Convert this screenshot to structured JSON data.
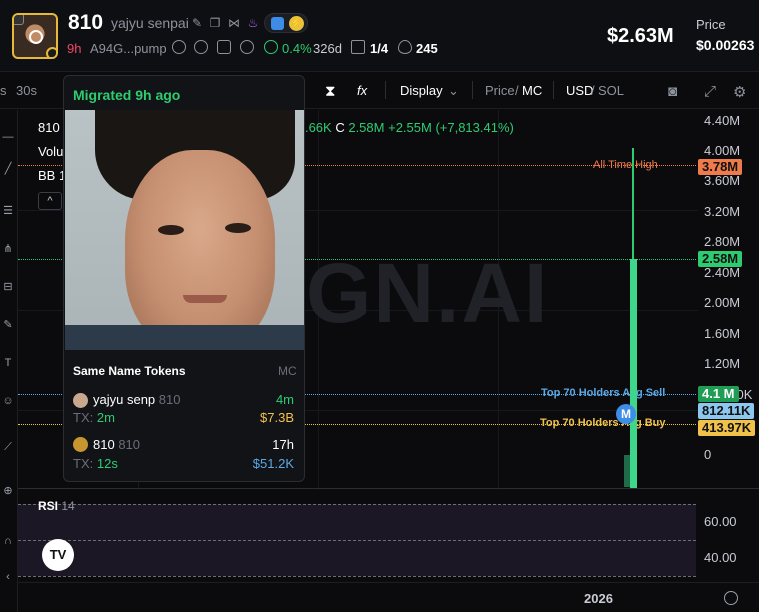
{
  "header": {
    "symbol": "810",
    "name": "yajyu senpai",
    "age": "9h",
    "address": "A94G...pump",
    "holders_pct": "0.4%",
    "holders_age": "326d",
    "pro_count": "1/4",
    "watchers": "245",
    "market_cap": "$2.63M",
    "price_label": "Price",
    "price_value": "$0.00263"
  },
  "toolbar": {
    "tf_s": "s",
    "tf_30s": "30s",
    "display": "Display",
    "price_mc_price": "Price",
    "price_mc_sep": "/",
    "price_mc_mc": "MC",
    "usd": "USD",
    "currency_sep": "/",
    "sol": "SOL"
  },
  "chart": {
    "watermark": "GN.AI",
    "ohlc_prefix": "810",
    "ohlc_h": ".66K",
    "ohlc_c_label": "C",
    "ohlc_c": "2.58M",
    "ohlc_change": "+2.55M (+7,813.41%)",
    "vol_label": "Volu",
    "bb_label": "BB 1",
    "collapse_icon": "^",
    "y_ticks": [
      "4.40M",
      "4.00M",
      "3.60M",
      "3.20M",
      "2.80M",
      "2.40M",
      "2.00M",
      "1.60M",
      "1.20M",
      "800.00K",
      "0"
    ],
    "ath_label": "All Time High",
    "ath_value": "3.78M",
    "current_value": "2.58M",
    "sell_label": "Top 70 Holders Avg Sell",
    "sell_value": "4.1 M",
    "mid_value": "812.11K",
    "buy_label": "Top 70 Holders Avg Buy",
    "buy_value": "413.97K",
    "marker": "M",
    "colors": {
      "green": "#2ecc71",
      "orange": "#f07b4a",
      "blue": "#5aa9e6",
      "yellow": "#f0c24a"
    }
  },
  "rsi": {
    "label": "RSI",
    "period": "14",
    "tick_top": "60.00",
    "tick_bottom": "40.00",
    "logo": "TV"
  },
  "time_axis": {
    "label": "2026"
  },
  "hover_card": {
    "migrated": "Migrated 9h ago",
    "section_title": "Same Name Tokens",
    "mc_label": "MC",
    "matches": [
      {
        "name": "yajyu senp",
        "symbol": "810",
        "age": "4m",
        "tx_label": "TX:",
        "tx": "2m",
        "mc": "$7.3B"
      },
      {
        "name": "810",
        "symbol": "810",
        "age": "17h",
        "tx_label": "TX:",
        "tx": "12s",
        "mc": "$51.2K"
      }
    ]
  }
}
